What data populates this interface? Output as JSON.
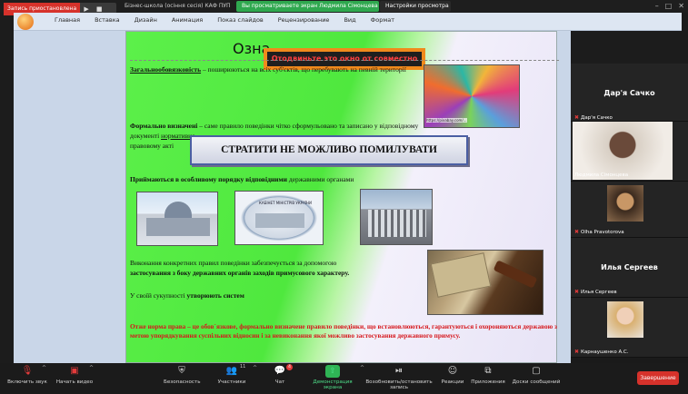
{
  "recording": {
    "label": "Запись приостановлена"
  },
  "doc_title": "Бізнес-школа (осіння сесія) КАФ ПУП",
  "share_bar": {
    "viewing": "Вы просматриваете экран Людмила Сімонцева",
    "view_options": "Настройки просмотра"
  },
  "ribbon": {
    "tabs": [
      "Главная",
      "Вставка",
      "Дизайн",
      "Анимация",
      "Показ слайдов",
      "Рецензирование",
      "Вид",
      "Формат"
    ]
  },
  "overlay": {
    "stop_share": "Отодвиньте это окно от совместно"
  },
  "slide": {
    "title_visible": "Озна",
    "t1_bold": "Загальнообовязковість",
    "t1_rest": " – поширюються на всіх суб'єктів, що перебувають на певній території",
    "t2_bold": "Формально визначені",
    "t2_rest_a": " – саме правило поведінки чітко сформульовано та записано у  відповідному документі ",
    "t2_rest_u": "нормативно-",
    "t2_rest_b": "правовому акті",
    "banner": "СТРАТИТИ НЕ МОЖЛИВО ПОМИЛУВАТИ",
    "t3_bold": "Приймаються в особливому порядку відповідними",
    "t3_rest": " державними органами",
    "t4_a": "Виконання конкретних правил поведінки забезпечується  за допомогою",
    "t4_bold": " застосування з боку державних органів  заходів примусового характеру.",
    "t5_a": "У своїй сукупності ",
    "t5_bold": "утворюють систем",
    "t6": "Отже норма права – це обов`язкове, формально визначене правило поведінки, що встановлюються, гарантуються і охороняються державою з метою упорядкування суспільних відносин і за невиконання якої можливо застосування державного примусу."
  },
  "gallery": {
    "tile1_big": "Дар'я Сачко",
    "tile1_name": "Дар'я Сачко",
    "tile2_name": "Людмила Сімонцева",
    "tile3_name": "Olha Pravotorova",
    "tile4_big": "Илья Сергеев",
    "tile4_name": "Илья Сергеев",
    "tile5_name": "Карнаушенко А.С."
  },
  "toolbar": {
    "mic": "Включить звук",
    "video": "Начать видео",
    "security": "Безопасность",
    "participants": "Участники",
    "participants_count": "11",
    "chat": "Чат",
    "chat_badge": "4",
    "share": "Демонстрация экрана",
    "record": "Возобновить/остановить запись",
    "reactions": "Реакции",
    "apps": "Приложения",
    "whiteboards": "Доски сообщений",
    "end": "Завершение"
  }
}
